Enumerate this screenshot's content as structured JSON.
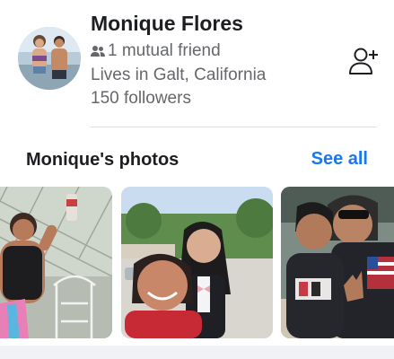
{
  "profile": {
    "name": "Monique Flores",
    "mutual_friends": "1 mutual friend",
    "location": "Lives in Galt, California",
    "followers": "150 followers",
    "icons": {
      "mutual": "friends-icon",
      "action": "add-friend-icon"
    }
  },
  "photos_section": {
    "title": "Monique's photos",
    "see_all": "See all",
    "photos": [
      {
        "name": "photo-1"
      },
      {
        "name": "photo-2"
      },
      {
        "name": "photo-3"
      }
    ]
  },
  "colors": {
    "link": "#1877f2",
    "secondary_text": "#65676b",
    "primary_text": "#1c1e21",
    "divider": "#dadde1"
  }
}
